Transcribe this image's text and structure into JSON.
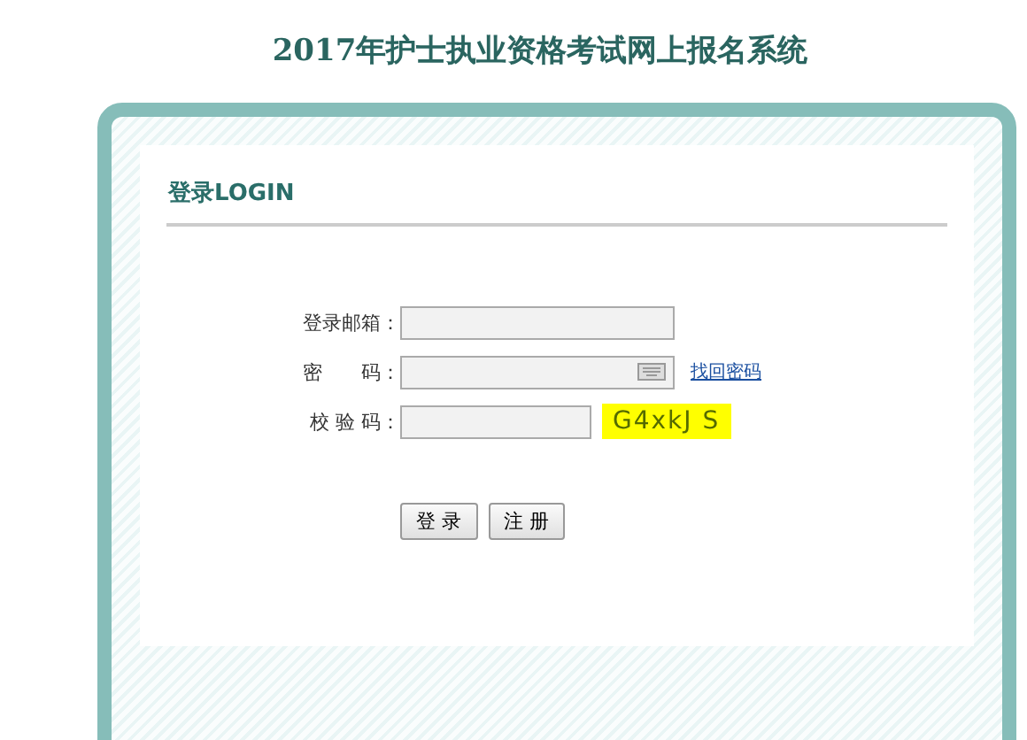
{
  "page_title": "2017年护士执业资格考试网上报名系统",
  "login_panel": {
    "heading": "登录LOGIN",
    "fields": [
      {
        "label": "登录邮箱：",
        "kind": "text"
      },
      {
        "label": "密　　码：",
        "kind": "password",
        "link": "找回密码"
      },
      {
        "label": "校 验 码：",
        "kind": "captcha",
        "captcha": "G4xkJ S"
      }
    ],
    "buttons": [
      "登 录",
      "注 册"
    ]
  }
}
